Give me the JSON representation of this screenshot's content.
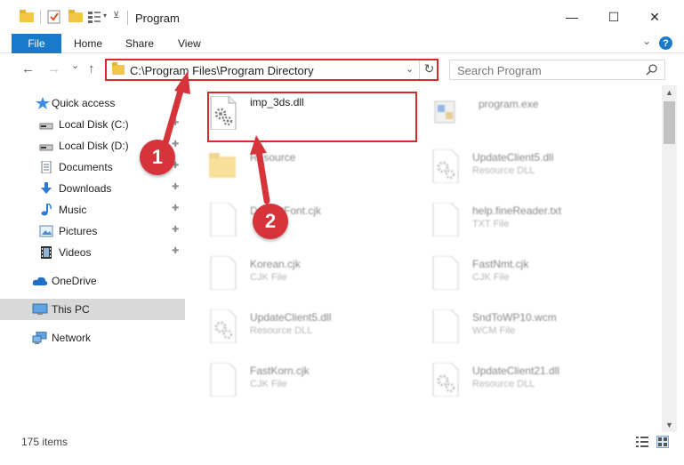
{
  "window": {
    "title": "Program",
    "minimize_glyph": "—",
    "maximize_glyph": "☐",
    "close_glyph": "✕"
  },
  "ribbon": {
    "tabs": [
      "File",
      "Home",
      "Share",
      "View"
    ],
    "expand_glyph": "⌄"
  },
  "navigation": {
    "back_glyph": "←",
    "forward_glyph": "→",
    "recent_glyph": "⌄",
    "up_glyph": "↑",
    "address_path": "C:\\Program Files\\Program Directory",
    "address_dropdown_glyph": "⌄",
    "refresh_glyph": "↻",
    "search_placeholder": "Search Program",
    "search_glyph": "⚲"
  },
  "sidebar": {
    "items": [
      {
        "label": "Quick access",
        "icon": "star-icon",
        "pinned": false
      },
      {
        "label": "Local Disk (C:)",
        "icon": "drive-icon",
        "pinned": true
      },
      {
        "label": "Local Disk (D:)",
        "icon": "drive-icon",
        "pinned": true
      },
      {
        "label": "Documents",
        "icon": "documents-icon",
        "pinned": true
      },
      {
        "label": "Downloads",
        "icon": "download-icon",
        "pinned": true
      },
      {
        "label": "Music",
        "icon": "music-icon",
        "pinned": true
      },
      {
        "label": "Pictures",
        "icon": "pictures-icon",
        "pinned": true
      },
      {
        "label": "Videos",
        "icon": "videos-icon",
        "pinned": true
      },
      {
        "label": "OneDrive",
        "icon": "cloud-icon",
        "pinned": false
      },
      {
        "label": "This PC",
        "icon": "computer-icon",
        "pinned": false,
        "selected": true
      },
      {
        "label": "Network",
        "icon": "network-icon",
        "pinned": false
      }
    ],
    "pin_glyph": "📌"
  },
  "files": [
    {
      "name": "imp_3ds.dll",
      "type": "",
      "icon": "dll-gear-icon",
      "highlighted": true
    },
    {
      "name": "program.exe",
      "type": "",
      "icon": "exe-icon"
    },
    {
      "name": "Resource",
      "type": "",
      "icon": "folder-icon"
    },
    {
      "name": "UpdateClient5.dll",
      "type": "Resource DLL",
      "icon": "dll-gear-icon"
    },
    {
      "name": "DefaultFont.cjk",
      "type": "",
      "icon": "blank-file-icon"
    },
    {
      "name": "help.fineReader.txt",
      "type": "TXT File",
      "icon": "text-file-icon"
    },
    {
      "name": "Korean.cjk",
      "type": "CJK File",
      "icon": "blank-file-icon"
    },
    {
      "name": "FastNmt.cjk",
      "type": "CJK File",
      "icon": "blank-file-icon"
    },
    {
      "name": "UpdateClient5.dll",
      "type": "Resource DLL",
      "icon": "dll-gear-icon"
    },
    {
      "name": "SndToWP10.wcm",
      "type": "WCM File",
      "icon": "blank-file-icon"
    },
    {
      "name": "FastKorn.cjk",
      "type": "CJK File",
      "icon": "blank-file-icon"
    },
    {
      "name": "UpdateClient21.dll",
      "type": "Resource DLL",
      "icon": "dll-gear-icon"
    }
  ],
  "status": {
    "item_count": "175 items"
  },
  "callouts": [
    "1",
    "2"
  ],
  "colors": {
    "accent": "#1979ca",
    "highlight": "#d62a2a",
    "callout": "#d6333b",
    "folder": "#f3c648"
  }
}
